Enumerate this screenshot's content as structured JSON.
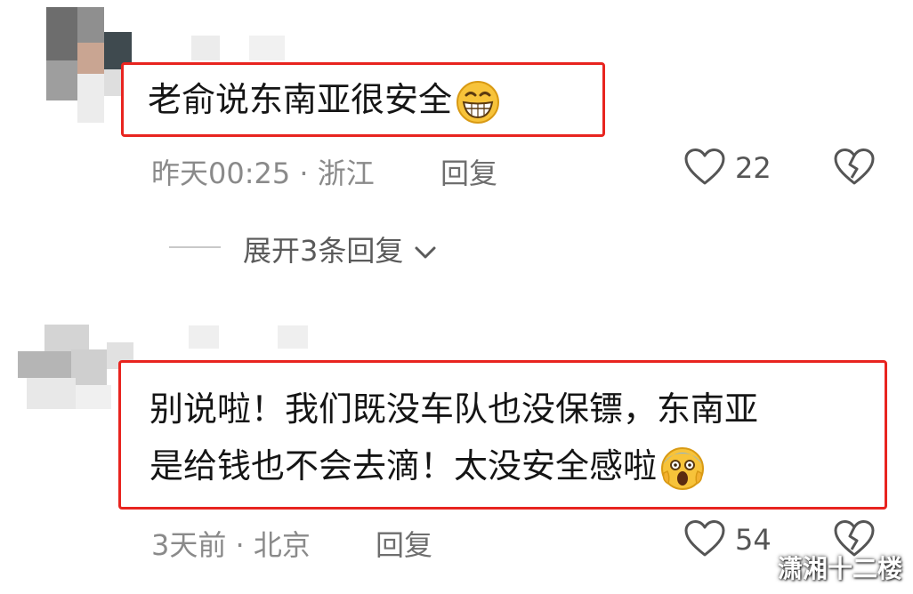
{
  "comments": [
    {
      "text_lines": [
        "老俞说东南亚很安全"
      ],
      "time": "昨天00:25",
      "separator": "·",
      "location": "浙江",
      "reply_label": "回复",
      "like_count": "22",
      "emoji_icon": "grinning-face-icon"
    },
    {
      "text_lines": [
        "别说啦！我们既没车队也没保镖，东南亚",
        "是给钱也不会去滴！太没安全感啦"
      ],
      "time": "3天前",
      "separator": "·",
      "location": "北京",
      "reply_label": "回复",
      "like_count": "54",
      "emoji_icon": "screaming-face-icon"
    }
  ],
  "expand_replies": {
    "label": "展开3条回复"
  },
  "watermark": "潇湘十二楼",
  "colors": {
    "highlight_border": "#e8241f",
    "meta_text": "#8a8a8a"
  }
}
